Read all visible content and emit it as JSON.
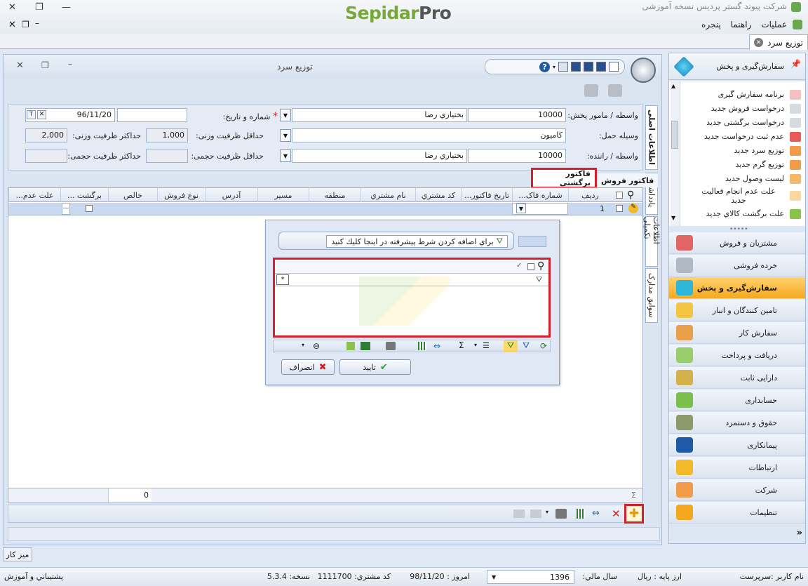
{
  "app": {
    "title": "شرکت پیوند گستر پردیس نسخه آموزشی",
    "logo_a": "Sepidar",
    "logo_b": "Pro",
    "menu": [
      "عملیات",
      "راهنما",
      "پنجره"
    ],
    "doc_tab": "توزیع سرد"
  },
  "window": {
    "title": "توزیع سرد",
    "help": "?"
  },
  "form": {
    "agent_label": "واسطه / مامور پخش:",
    "agent_code": "10000",
    "agent_name": "بختياري رضا",
    "number_date_label": "شماره و تاریخ:",
    "required_mark": "*",
    "number_value": "",
    "date_value": "96/11/20",
    "vehicle_label": "وسیله حمل:",
    "vehicle_value": "کامیون",
    "min_weight_label": "حداقل ظرفیت وزنی:",
    "min_weight_value": "1,000",
    "max_weight_label": "حداکثر ظرفیت وزنی:",
    "max_weight_value": "2,000",
    "driver_label": "واسطه / راننده:",
    "driver_code": "10000",
    "driver_name": "بختياري رضا",
    "min_volume_label": "حداقل ظرفیت حجمی:",
    "min_volume_value": "",
    "max_volume_label": "حداکثر ظرفیت حجمی:",
    "max_volume_value": ""
  },
  "side_tabs": [
    "اطلاعات اصلی",
    "یادداشت",
    "اطلاعات تکمیلی",
    "سوابق مدارک"
  ],
  "subtabs": {
    "active": "فاکتور برگشتی",
    "other": "فاکتور فروش"
  },
  "grid": {
    "columns": [
      "ردیف",
      "شماره فاک...",
      "تاریخ فاکتور...",
      "کد مشتري",
      "نام مشتري",
      "منطقه",
      "مسیر",
      "آدرس",
      "نوع فروش",
      "خالص",
      "برگشت ...",
      "علت عدم..."
    ],
    "row_number": "1",
    "footer_total": "0",
    "footer_sigma": "Σ"
  },
  "popup": {
    "condition_hint": "براي اضافه كردن شرط پيشرفته در اينجا كليك كنيد",
    "filter_star": "*",
    "ok_label": "تایید",
    "cancel_label": "انصراف"
  },
  "right_panel": {
    "header": "سفارش‌گیری و پخش",
    "items": [
      "برنامه سفارش گیری",
      "درخواست فروش جدید",
      "درخواست برگشتی جدید",
      "عدم ثبت درخواست جدید",
      "توزیع سرد جدید",
      "توزیع گرم جدید",
      "لیست وصول جدید",
      "علت عدم انجام فعالیت جدید",
      "علت برگشت كالاي جدید"
    ],
    "modules": [
      "مشتریان و فروش",
      "خرده فروشی",
      "سفارش‌گیری و پخش",
      "تامین کنندگان و انبار",
      "سفارش کار",
      "دریافت و پرداخت",
      "دارایی ثابت",
      "حسابداری",
      "حقوق و دستمزد",
      "پیمانکاری",
      "ارتباطات",
      "شرکت",
      "تنظیمات"
    ],
    "selected_module_index": 2,
    "more": "»"
  },
  "desk_button": "میز کار",
  "status": {
    "user": "نام کاربر :سرپرست",
    "currency": "ارز پایه : ریال",
    "fiscal_year_label": "سال مالي:",
    "fiscal_year": "1396",
    "today": "امروز :   98/11/20",
    "customer_code": "کد مشتري:   1111700",
    "version": "نسخه:   5.3.4",
    "support": "پشتیباني و آموزش"
  },
  "colors": {
    "accent": "#f4a81f",
    "highlight_box": "#d4202a",
    "logo_green": "#7aa73a"
  }
}
